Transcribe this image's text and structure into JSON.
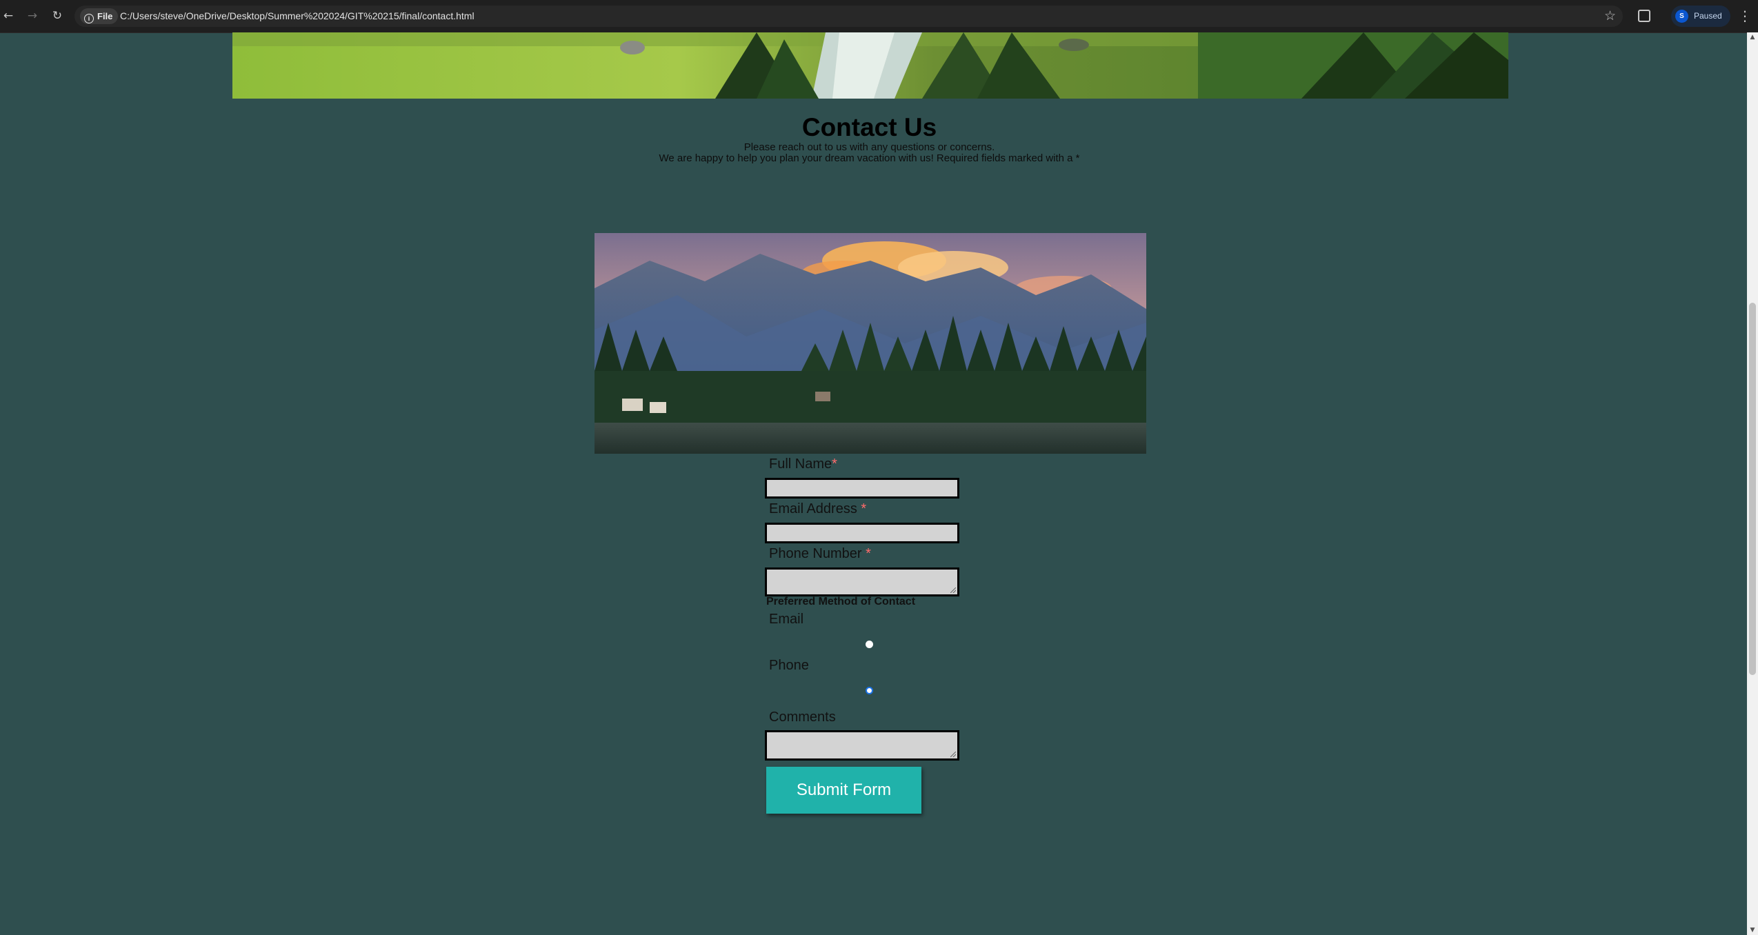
{
  "browser": {
    "back_icon": "back-arrow-icon",
    "forward_icon": "forward-arrow-icon",
    "reload_icon": "reload-icon",
    "site_chip_label": "File",
    "url": "C:/Users/steve/OneDrive/Desktop/Summer%202024/GIT%20215/final/contact.html",
    "profile_initial": "S",
    "profile_status": "Paused"
  },
  "page": {
    "heading": "Contact Us",
    "subtitle_line1": "Please reach out to us with any questions or concerns.",
    "subtitle_line2": "We are happy to help you plan your dream vacation with us! Required fields marked with a *",
    "background_color": "#2f4f4f",
    "banner_image": "forest-river-photo",
    "hero_image": "mountain-lake-sunset-photo"
  },
  "form": {
    "full_name_label": "Full Name",
    "full_name_required": "*",
    "full_name_value": "",
    "email_label": "Email Address ",
    "email_required": "*",
    "email_value": "",
    "phone_label": "Phone Number ",
    "phone_required": "*",
    "phone_value": "",
    "preferred_contact_legend": "Preferred Method of Contact",
    "contact_options": [
      {
        "label": "Email",
        "selected": false
      },
      {
        "label": "Phone",
        "selected": true
      }
    ],
    "comments_label": "Comments",
    "comments_value": "",
    "submit_label": "Submit Form",
    "submit_color": "#20b2aa",
    "required_color": "#ff6b6b"
  }
}
